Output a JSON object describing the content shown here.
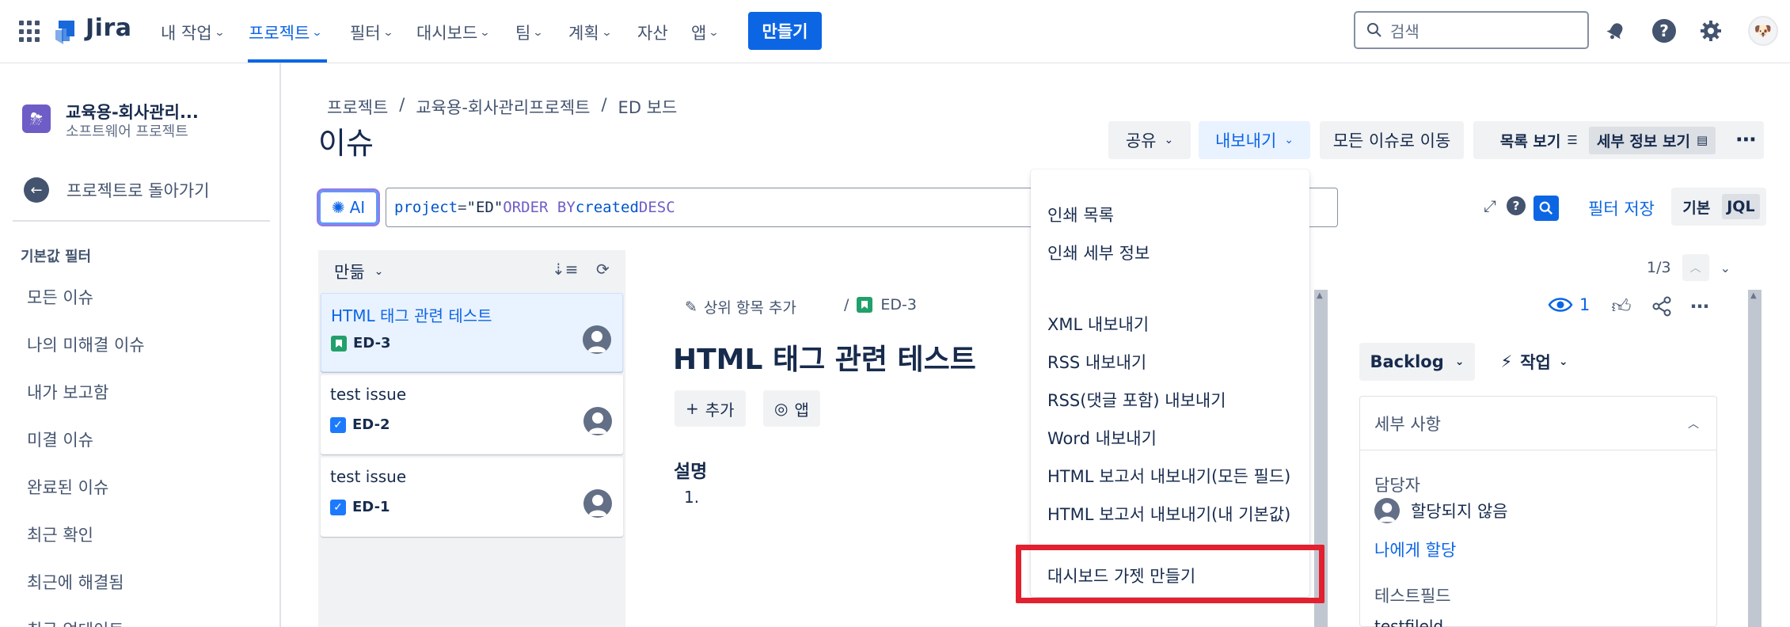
{
  "topnav": {
    "app_name": "Jira",
    "items": [
      {
        "label": "내 작업"
      },
      {
        "label": "프로젝트"
      },
      {
        "label": "필터"
      },
      {
        "label": "대시보드"
      },
      {
        "label": "팀"
      },
      {
        "label": "계획"
      },
      {
        "label": "자산"
      },
      {
        "label": "앱"
      }
    ],
    "active_item": "프로젝트",
    "create_label": "만들기",
    "search_placeholder": "검색",
    "accent_color": "#0c66e4"
  },
  "sidebar": {
    "project_name": "교육용-회사관리...",
    "project_type": "소프트웨어 프로젝트",
    "back_label": "프로젝트로 돌아가기",
    "section_title": "기본값 필터",
    "filters": [
      "모든 이슈",
      "나의 미해결 이슈",
      "내가 보고함",
      "미결 이슈",
      "완료된 이슈",
      "최근 확인",
      "최근에 해결됨",
      "최근 업데이트"
    ]
  },
  "header": {
    "breadcrumb": [
      "프로젝트",
      "/",
      "교육용-회사관리프로젝트",
      "/",
      "ED 보드"
    ],
    "title": "이슈",
    "share_label": "공유",
    "export_label": "내보내기",
    "go_all_label": "모든 이슈로 이동",
    "list_view_label": "목록 보기",
    "detail_view_label": "세부 정보 보기"
  },
  "jql": {
    "ai_label": "AI",
    "query": {
      "field": "project",
      "op": "=",
      "value": "\"ED\"",
      "order": "ORDER BY",
      "sort_field": "created",
      "direction": "DESC"
    },
    "save_filter_label": "필터 저장",
    "mode_basic": "기본",
    "mode_jql": "JQL"
  },
  "issue_list": {
    "sort_label": "만듦",
    "issues": [
      {
        "title": "HTML 태그 관련 테스트",
        "key": "ED-3",
        "type": "story"
      },
      {
        "title": "test issue",
        "key": "ED-2",
        "type": "task"
      },
      {
        "title": "test issue",
        "key": "ED-1",
        "type": "task"
      }
    ]
  },
  "issue_detail": {
    "add_parent_label": "상위 항목 추가",
    "key": "ED-3",
    "title": "HTML 태그 관련 테스트",
    "add_label": "추가",
    "apps_label": "앱",
    "description_heading": "설명",
    "description_item": "1."
  },
  "right_panel": {
    "pager": "1/3",
    "watchers": "1",
    "status": "Backlog",
    "action_label": "작업",
    "details_heading": "세부 사항",
    "assignee_label": "담당자",
    "assignee_value": "할당되지 않음",
    "assign_to_me": "나에게 할당",
    "test_field_label": "테스트필드",
    "test_field_value": "testfileld"
  },
  "export_menu": {
    "items": [
      "인쇄 목록",
      "인쇄 세부 정보",
      "XML 내보내기",
      "RSS 내보내기",
      "RSS(댓글 포함) 내보내기",
      "Word 내보내기",
      "HTML 보고서 내보내기(모든 필드)",
      "HTML 보고서 내보내기(내 기본값)",
      "대시보드 가젯 만들기"
    ],
    "highlighted_item": "대시보드 가젯 만들기",
    "highlight_color": "#e2202f"
  }
}
